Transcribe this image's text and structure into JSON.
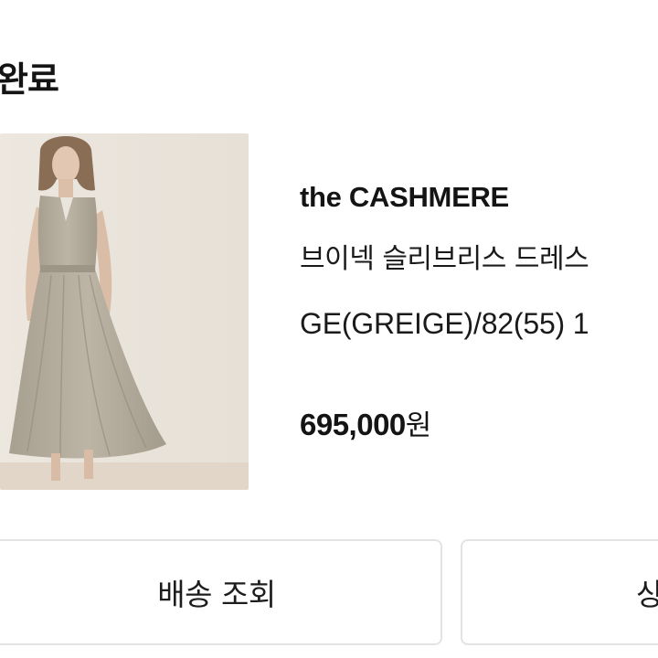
{
  "header": {
    "title": "완료"
  },
  "product": {
    "brand": "the CASHMERE",
    "name": "브이넥 슬리브리스 드레스",
    "option": "GE(GREIGE)/82(55) 1",
    "price": "695,000",
    "currency": "원",
    "image_icon": "product-photo-dress"
  },
  "actions": {
    "track_label": "배송 조회",
    "detail_label": "상"
  },
  "colors": {
    "photo_bg": "#e9e3da",
    "dress": "#b3ab9b",
    "button_border": "#e3e3e3"
  }
}
